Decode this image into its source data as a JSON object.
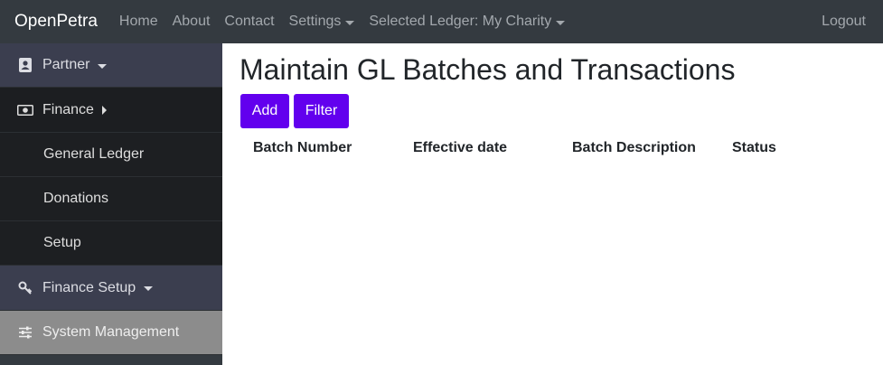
{
  "navbar": {
    "brand": "OpenPetra",
    "links": [
      "Home",
      "About",
      "Contact"
    ],
    "settings": "Settings",
    "ledger": "Selected Ledger: My Charity",
    "logout": "Logout"
  },
  "sidebar": {
    "partner": "Partner",
    "finance": "Finance",
    "finance_items": [
      "General Ledger",
      "Donations",
      "Setup"
    ],
    "finance_setup": "Finance Setup",
    "system_management": "System Management"
  },
  "main": {
    "title": "Maintain GL Batches and Transactions",
    "add_button": "Add",
    "filter_button": "Filter",
    "columns": [
      "Batch Number",
      "Effective date",
      "Batch Description",
      "Status"
    ]
  },
  "colors": {
    "navbar": "#343a40",
    "button": "#6200ee",
    "sidebar_active": "#8c8c8c"
  }
}
